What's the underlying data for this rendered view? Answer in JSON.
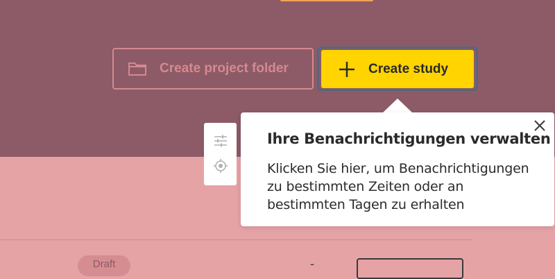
{
  "header": {
    "create_folder_label": "Create project folder",
    "create_study_label": "Create study"
  },
  "popover": {
    "title": "Ihre Benachrichtigungen verwalten",
    "body": "Klicken Sie hier, um Benachrichtigungen zu bestimmten Zeiten oder an bestimmten Tagen zu erhalten"
  },
  "toolbar": {
    "icons": [
      "sliders-icon",
      "target-icon"
    ]
  },
  "row": {
    "status_badge": "Draft",
    "dash": "-"
  },
  "colors": {
    "primary_button": "#ffd400",
    "overlay_top": "#8c5b67",
    "overlay_bottom": "#e6a3a6",
    "accent_orange": "#f0a356"
  }
}
